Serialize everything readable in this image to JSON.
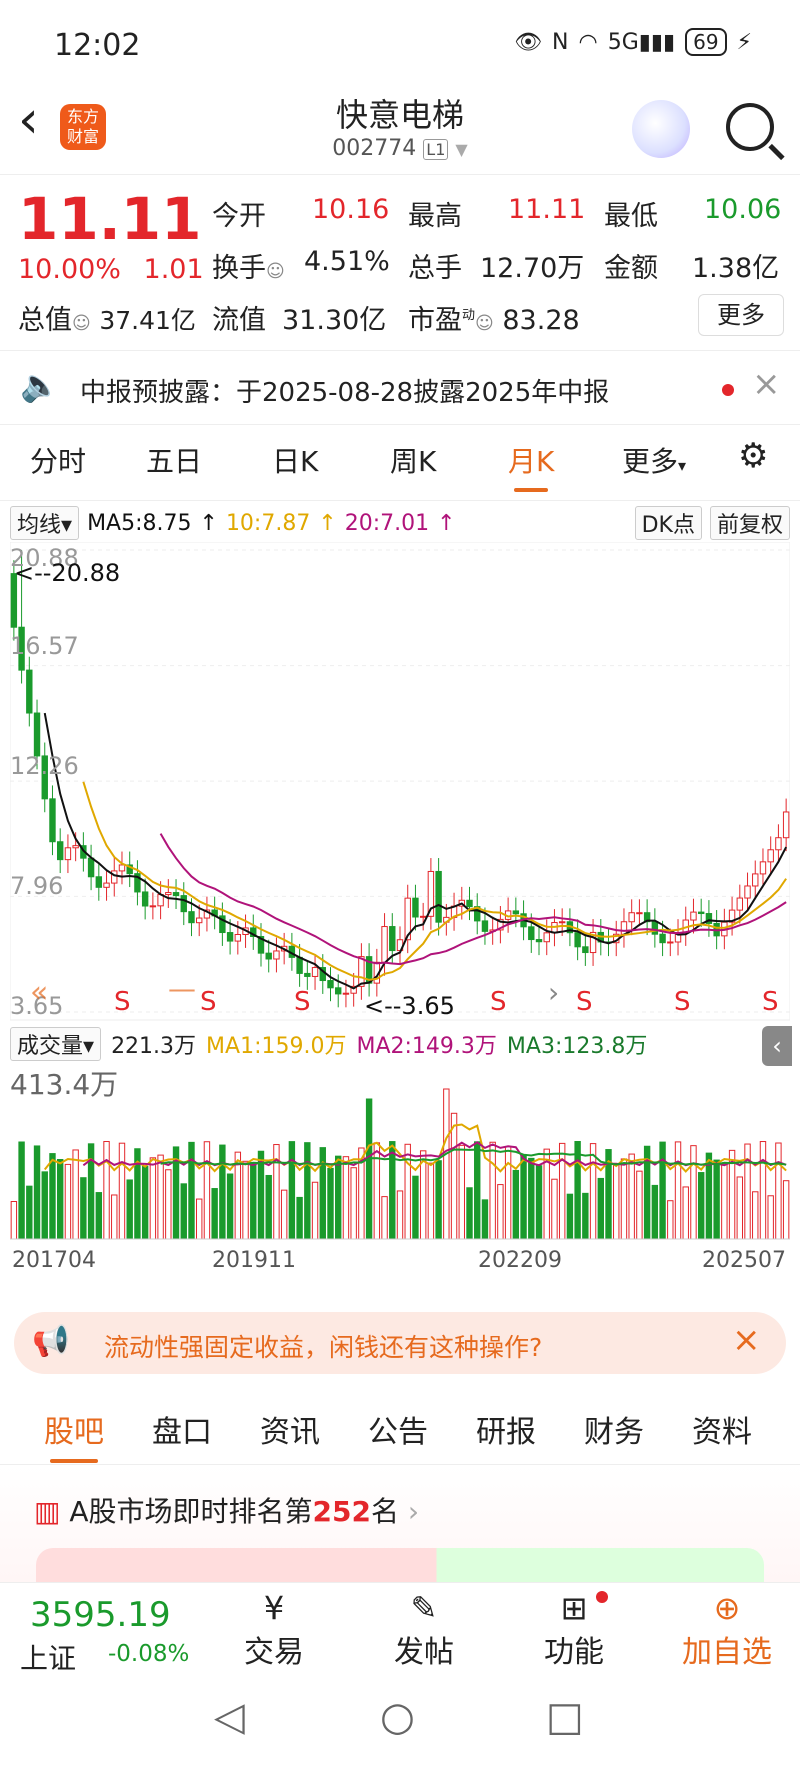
{
  "status": {
    "time": "12:02",
    "battery": "69"
  },
  "header": {
    "logo_text": "东方财富",
    "title": "快意电梯",
    "code": "002774",
    "level": "L1"
  },
  "quote": {
    "price": "11.11",
    "pct": "10.00%",
    "change": "1.01",
    "open_label": "今开",
    "open": "10.16",
    "high_label": "最高",
    "high": "11.11",
    "low_label": "最低",
    "low": "10.06",
    "turnover_label": "换手",
    "turnover": "4.51%",
    "volume_label": "总手",
    "volume": "12.70万",
    "amount_label": "金额",
    "amount": "1.38亿",
    "mktcap_label": "总值",
    "mktcap": "37.41亿",
    "float_label": "流值",
    "float": "31.30亿",
    "pe_label": "市盈",
    "pe_sup": "动",
    "pe": "83.28",
    "more": "更多"
  },
  "notice": {
    "text": "中报预披露：于2025-08-28披露2025年中报"
  },
  "tabs": [
    "分时",
    "五日",
    "日K",
    "周K",
    "月K",
    "更多"
  ],
  "ma_bar": {
    "label": "均线",
    "ma5": "MA5:8.75",
    "ma10": "10:7.87",
    "ma20": "20:7.01",
    "dk": "DK点",
    "fq": "前复权"
  },
  "chart_axis": {
    "y_labels": [
      "20.88",
      "16.57",
      "12.26",
      "7.96",
      "3.65"
    ],
    "max_marker": "<--20.88",
    "min_marker": "<--3.65"
  },
  "vol_bar": {
    "label": "成交量",
    "v": "221.3万",
    "ma1": "MA1:159.0万",
    "ma2": "MA2:149.3万",
    "ma3": "MA3:123.8万"
  },
  "vol_axis": {
    "max": "413.4万"
  },
  "dates": [
    "201704",
    "201911",
    "202209",
    "202507"
  ],
  "ad": {
    "text": "流动性强固定收益，闲钱还有这种操作?"
  },
  "bottom_tabs": [
    "股吧",
    "盘口",
    "资讯",
    "公告",
    "研报",
    "财务",
    "资料"
  ],
  "rank": {
    "prefix": "A股市场即时排名第",
    "num": "252",
    "suffix": "名"
  },
  "index": {
    "value": "3595.19",
    "name": "上证",
    "pct": "-0.08%"
  },
  "actions": [
    {
      "label": "交易",
      "icon": "yuan-icon"
    },
    {
      "label": "发帖",
      "icon": "edit-icon"
    },
    {
      "label": "功能",
      "icon": "grid-icon"
    },
    {
      "label": "加自选",
      "icon": "plus-circle-icon"
    }
  ],
  "colors": {
    "up": "#e3262b",
    "down": "#1a9a2c",
    "accent": "#e66a1e",
    "ma5": "#111111",
    "ma10": "#e0a800",
    "ma20": "#b0137a"
  },
  "chart_data": {
    "type": "candlestick",
    "interval": "monthly",
    "x_start": "201704",
    "x_end": "202507",
    "ylim": [
      3.65,
      20.88
    ],
    "high_point": 20.88,
    "low_point": 3.65,
    "last_close": 11.11,
    "ma": {
      "MA5": 8.75,
      "MA10": 7.87,
      "MA20": 7.01
    },
    "volume": {
      "max": "413.4万",
      "last": "221.3万",
      "MA1": "159.0万",
      "MA2": "149.3万",
      "MA3": "123.8万"
    }
  }
}
